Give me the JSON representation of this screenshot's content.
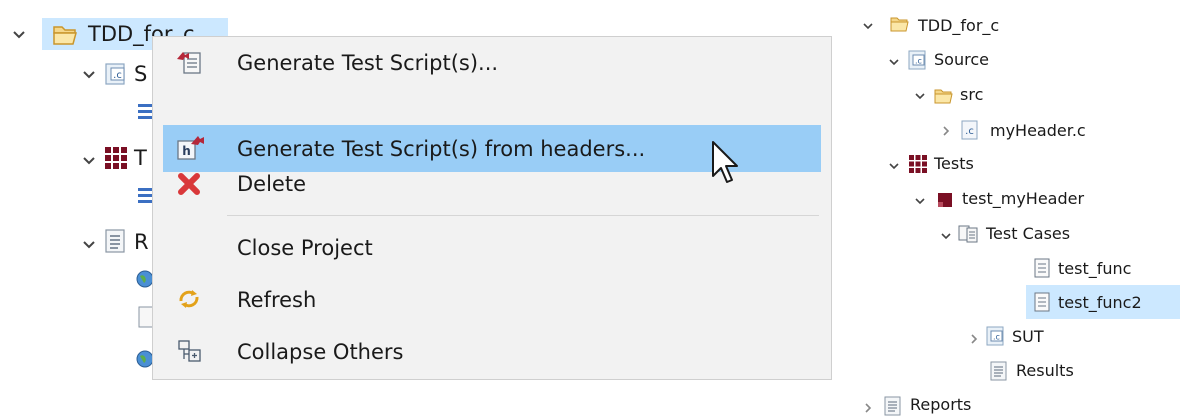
{
  "left_tree": {
    "project": "TDD_for_c",
    "source_label_partial": "S",
    "tests_label_partial": "T",
    "reports_label_partial": "R"
  },
  "context_menu": {
    "items": [
      {
        "label": "Generate Test Script(s)...",
        "icon": "test-script-icon"
      },
      {
        "label": "Generate Test Script(s) from headers...",
        "icon": "header-script-icon",
        "highlighted": true
      },
      {
        "label": "Delete",
        "icon": "delete-icon"
      },
      {
        "label": "Close Project",
        "icon": ""
      },
      {
        "label": "Refresh",
        "icon": "refresh-icon"
      },
      {
        "label": "Collapse Others",
        "icon": "collapse-icon"
      }
    ]
  },
  "right_tree": {
    "project": "TDD_for_c",
    "source": "Source",
    "src": "src",
    "my_header_c": "myHeader.c",
    "tests": "Tests",
    "test_my_header": "test_myHeader",
    "test_cases": "Test Cases",
    "test_func": "test_func",
    "test_func2": "test_func2",
    "sut": "SUT",
    "results": "Results",
    "reports": "Reports"
  },
  "colors": {
    "selection": "#cce8ff",
    "menu_highlight": "#99cdf6",
    "menu_bg": "#f2f2f2",
    "folder": "#e8b84a",
    "delete_red": "#d9383a",
    "tests_grid": "#7a0f24"
  }
}
